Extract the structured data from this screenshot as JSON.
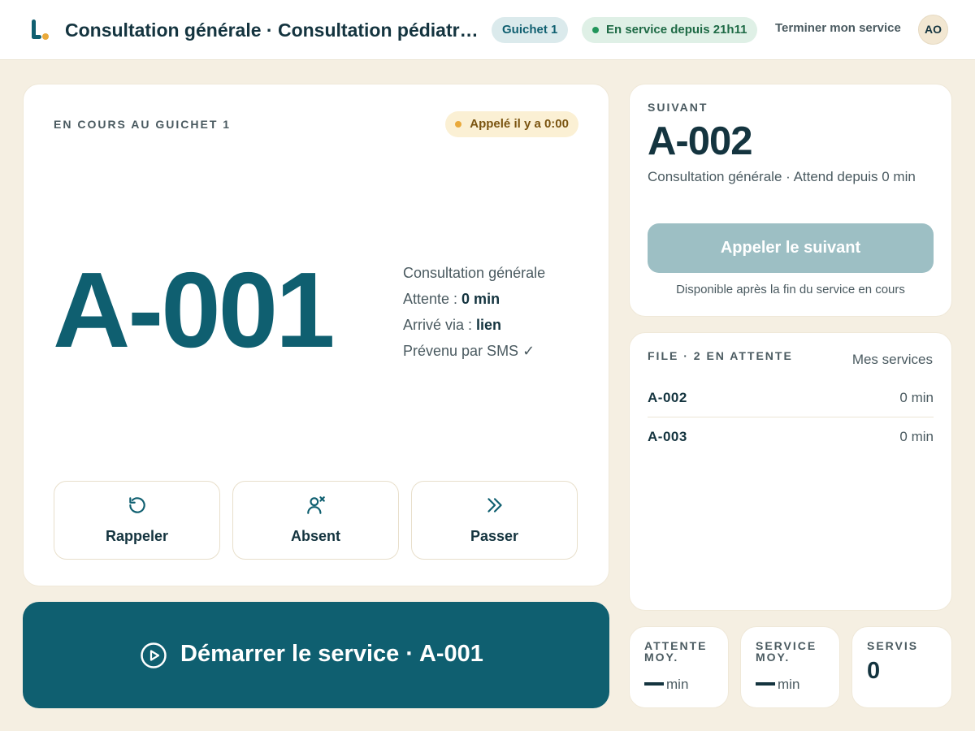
{
  "header": {
    "title": "Consultation générale · Consultation pédiatrique",
    "guichet": "Guichet 1",
    "service_status": "En service depuis 21h11",
    "end_service": "Terminer mon service",
    "avatar": "AO"
  },
  "current": {
    "eyebrow": "EN COURS AU GUICHET 1",
    "called_badge": "Appelé il y a 0:00",
    "ticket": "A-001",
    "service": "Consultation générale",
    "wait_label": "Attente : ",
    "wait_value": "0 min",
    "arrival_label": "Arrivé via : ",
    "arrival_value": "lien",
    "sms": "Prévenu par SMS ✓",
    "actions": [
      {
        "label": "Rappeler",
        "icon": "recall-icon"
      },
      {
        "label": "Absent",
        "icon": "absent-icon"
      },
      {
        "label": "Passer",
        "icon": "skip-icon"
      }
    ],
    "start_label": "Démarrer le service · A-001"
  },
  "next": {
    "eyebrow": "SUIVANT",
    "ticket": "A-002",
    "meta": "Consultation générale · Attend depuis 0 min",
    "call_button": "Appeler le suivant",
    "hint": "Disponible après la fin du service en cours"
  },
  "queue": {
    "eyebrow": "FILE · 2 EN ATTENTE",
    "filter": "Mes services",
    "rows": [
      {
        "ticket": "A-002",
        "wait": "0 min"
      },
      {
        "ticket": "A-003",
        "wait": "0 min"
      }
    ]
  },
  "stats": {
    "avg_wait_label": "ATTENTE MOY.",
    "avg_wait_unit": "min",
    "avg_service_label": "SERVICE MOY.",
    "avg_service_unit": "min",
    "served_label": "SERVIS",
    "served_value": "0"
  },
  "colors": {
    "primary": "#0f5f70",
    "background": "#f5efe2",
    "accent": "#e9a93b",
    "success": "#21955a"
  }
}
